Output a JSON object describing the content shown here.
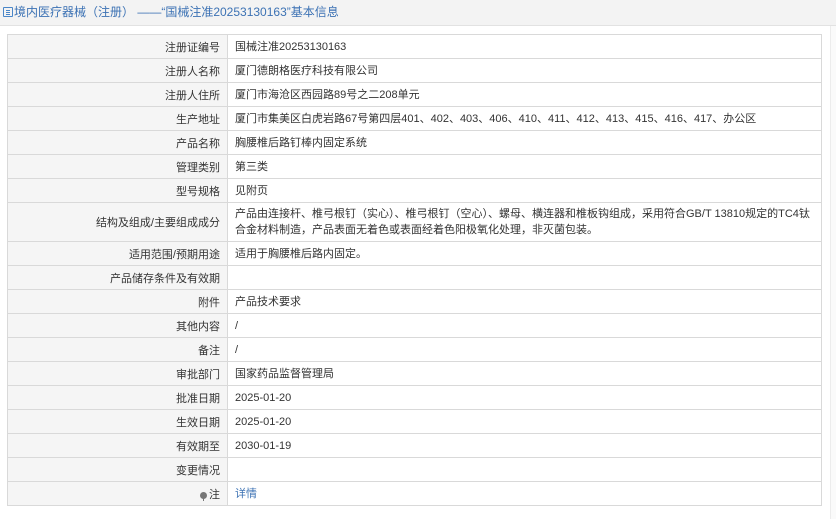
{
  "header": {
    "title": "境内医疗器械（注册） ——“国械注准20253130163”基本信息"
  },
  "rows": [
    {
      "label": "注册证编号",
      "value": "国械注准20253130163"
    },
    {
      "label": "注册人名称",
      "value": "厦门德朗格医疗科技有限公司"
    },
    {
      "label": "注册人住所",
      "value": "厦门市海沧区西园路89号之二208单元"
    },
    {
      "label": "生产地址",
      "value": "厦门市集美区白虎岩路67号第四层401、402、403、406、410、411、412、413、415、416、417、办公区"
    },
    {
      "label": "产品名称",
      "value": "胸腰椎后路钉棒内固定系统"
    },
    {
      "label": "管理类别",
      "value": "第三类"
    },
    {
      "label": "型号规格",
      "value": "见附页"
    },
    {
      "label": "结构及组成/主要组成成分",
      "value": "产品由连接杆、椎弓根钉（实心）、椎弓根钉（空心）、螺母、横连器和椎板钩组成，采用符合GB/T 13810规定的TC4钛合金材料制造，产品表面无着色或表面经着色阳极氧化处理，非灭菌包装。"
    },
    {
      "label": "适用范围/预期用途",
      "value": "适用于胸腰椎后路内固定。"
    },
    {
      "label": "产品储存条件及有效期",
      "value": ""
    },
    {
      "label": "附件",
      "value": "产品技术要求"
    },
    {
      "label": "其他内容",
      "value": "/"
    },
    {
      "label": "备注",
      "value": "/"
    },
    {
      "label": "审批部门",
      "value": "国家药品监督管理局"
    },
    {
      "label": "批准日期",
      "value": "2025-01-20"
    },
    {
      "label": "生效日期",
      "value": "2025-01-20"
    },
    {
      "label": "有效期至",
      "value": "2030-01-19"
    },
    {
      "label": "变更情况",
      "value": ""
    }
  ],
  "note_row": {
    "label": "注",
    "link": "详情"
  },
  "colors": {
    "header_bg": "#f3f3f3",
    "header_text": "#3c72b4",
    "label_bg": "#f5f5f5",
    "border": "#d9d9d9",
    "link": "#3c72b4"
  },
  "icons": {
    "header": "list-icon",
    "note": "pin-icon"
  }
}
